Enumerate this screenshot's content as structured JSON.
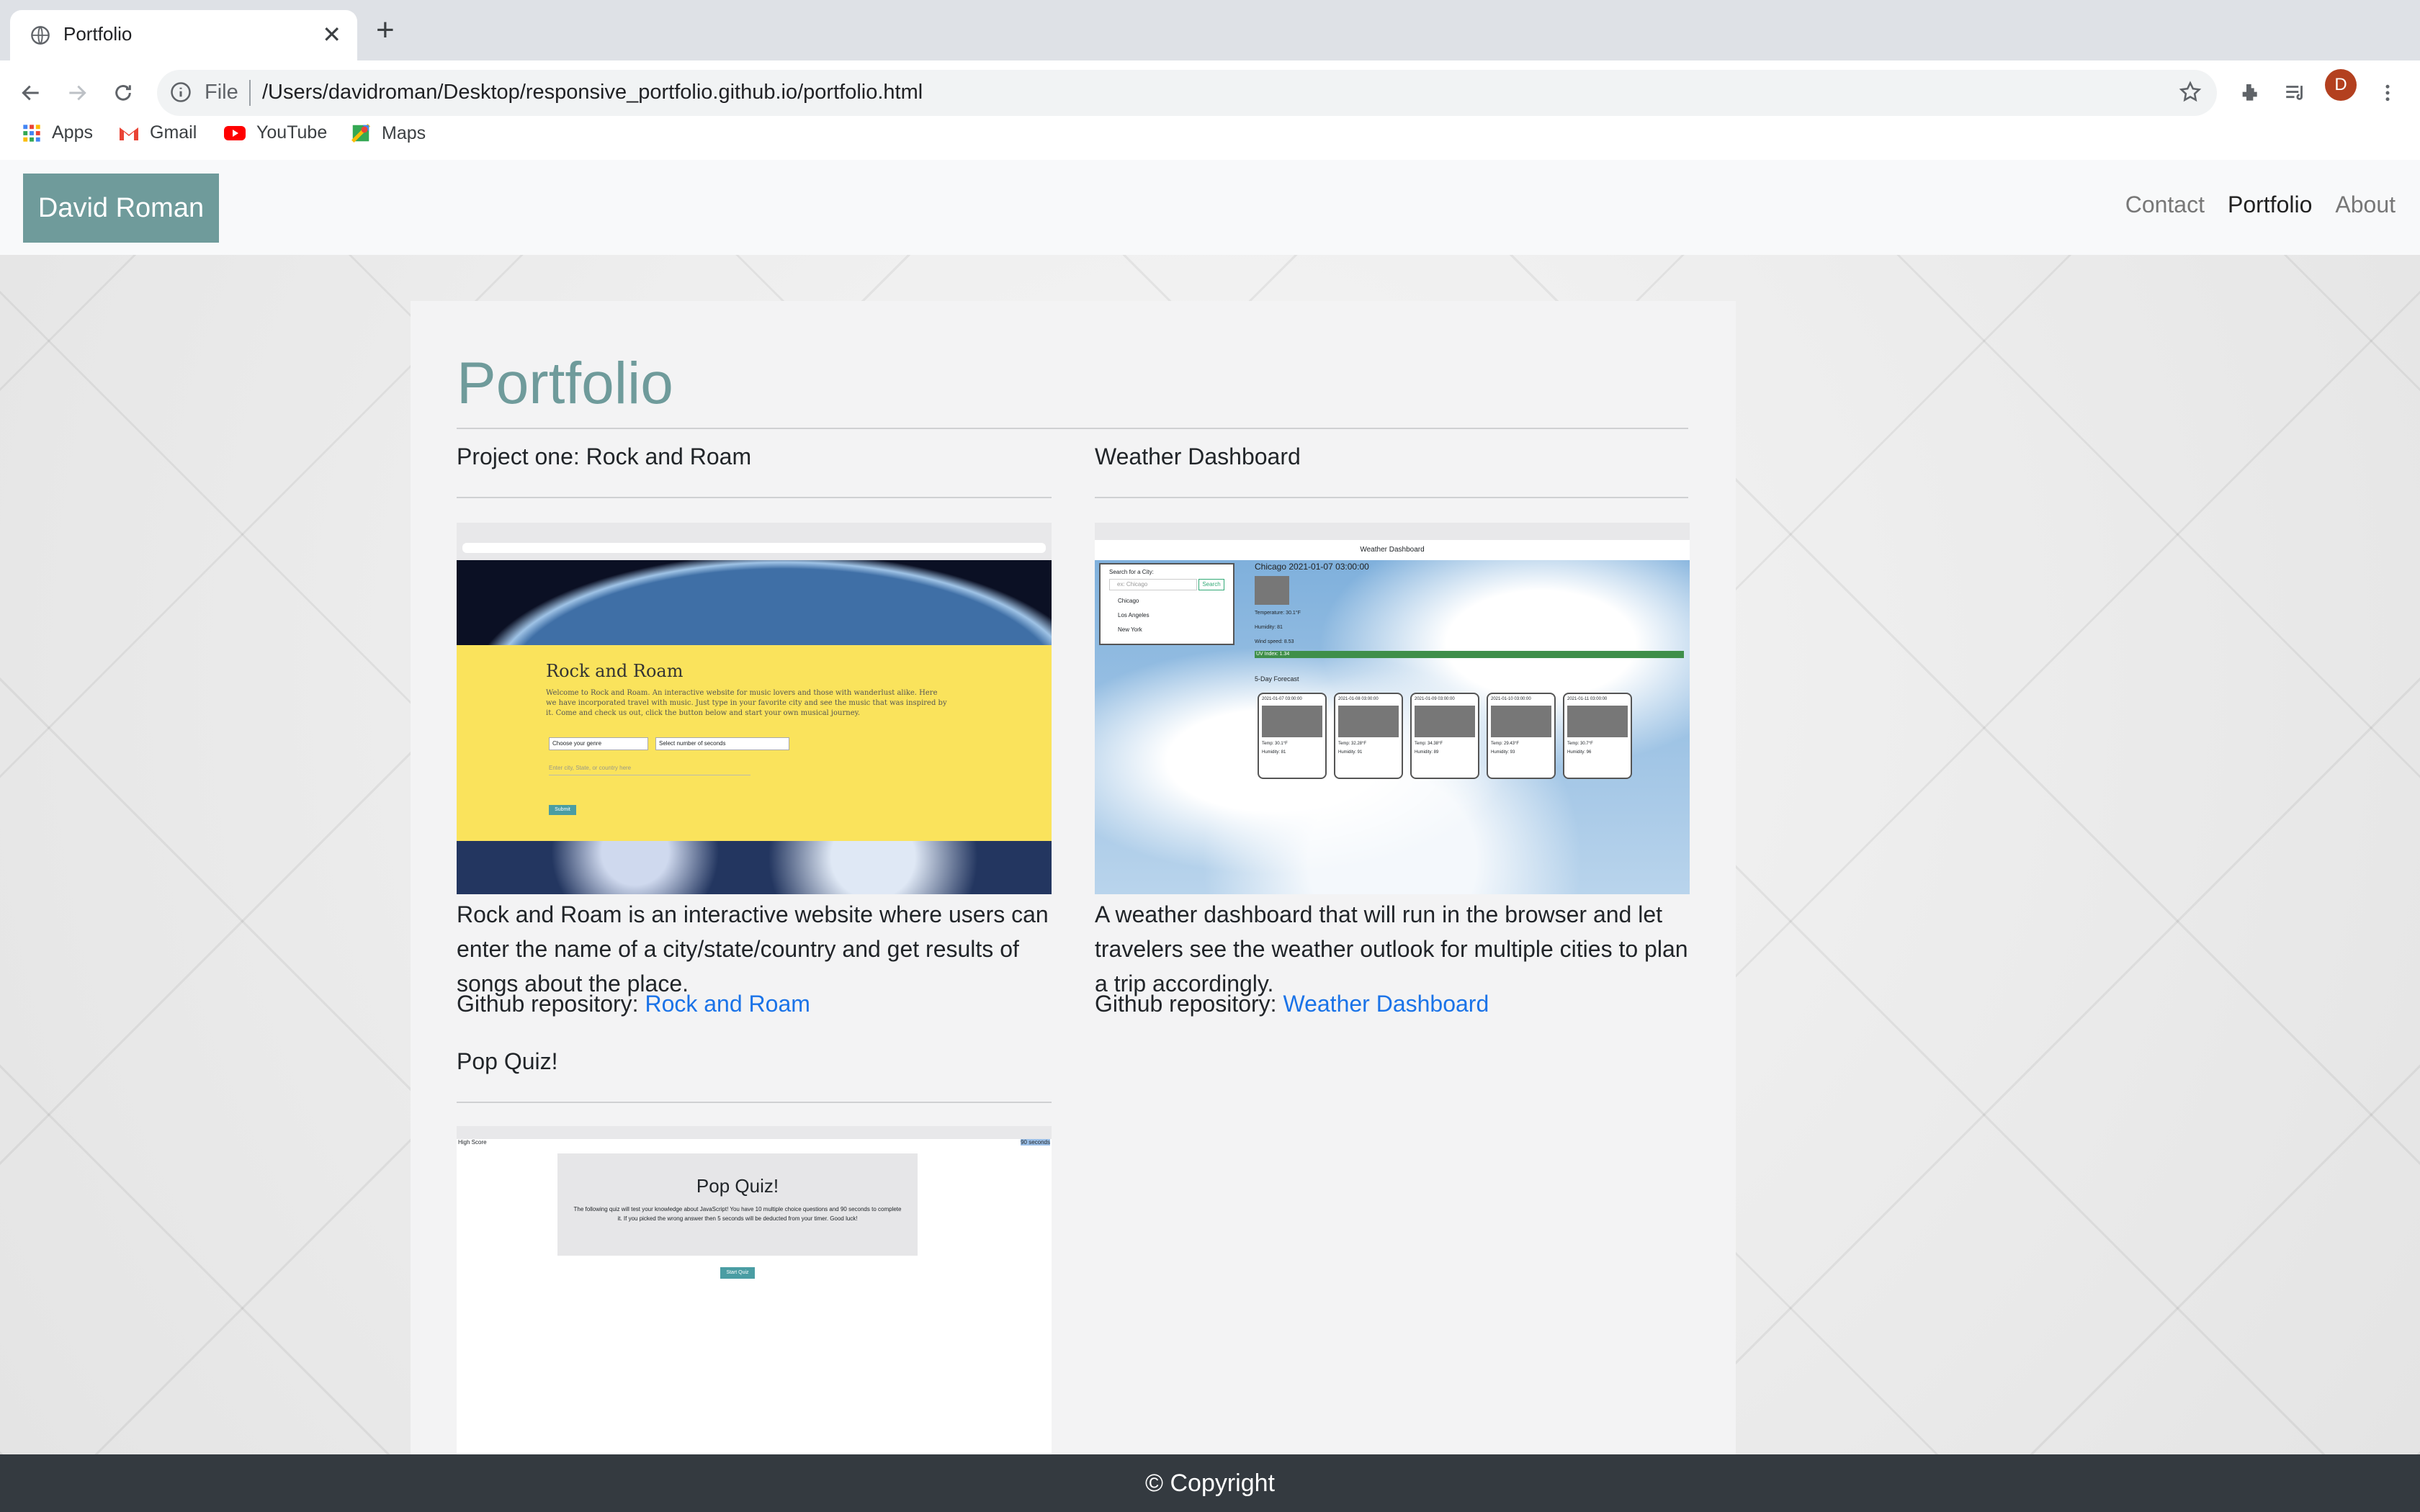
{
  "browser": {
    "tab_title": "Portfolio",
    "address_scheme": "File",
    "address_url": "/Users/davidroman/Desktop/responsive_portfolio.github.io/portfolio.html",
    "avatar_letter": "D",
    "bookmarks": [
      "Apps",
      "Gmail",
      "YouTube",
      "Maps"
    ]
  },
  "site": {
    "brand": "David Roman",
    "nav": [
      "Contact",
      "Portfolio",
      "About"
    ],
    "active_nav": "Portfolio",
    "accent_color": "#6f9b9b",
    "footer": "© Copyright"
  },
  "main": {
    "title": "Portfolio",
    "projects": [
      {
        "heading": "Project one: Rock and Roam",
        "description": "Rock and Roam is an interactive website where users can enter the name of a city/state/country and get results of songs about the place.",
        "repo_prefix": "Github repository:",
        "repo_link": "Rock and Roam",
        "shot": {
          "title": "Rock and Roam",
          "text": "Welcome to Rock and Roam. An interactive website for music lovers and those with wanderlust alike. Here we have incorporated travel with music. Just type in your favorite city and see the music that was inspired by it. Come and check us out, click the button below and start your own musical journey.",
          "select1": "Choose your genre",
          "select2": "Select number of seconds",
          "input": "Enter city, State, or country here",
          "button": "Submit"
        }
      },
      {
        "heading": "Weather Dashboard",
        "description": "A weather dashboard that will run in the browser and let travelers see the weather outlook for multiple cities to plan a trip accordingly.",
        "repo_prefix": "Github repository:",
        "repo_link": "Weather Dashboard",
        "shot": {
          "title": "Weather Dashboard",
          "search_label": "Search for a City:",
          "search_placeholder": "ex: Chicago",
          "search_button": "Search",
          "cities": [
            "Chicago",
            "Los Angeles",
            "New York"
          ],
          "current": "Chicago 2021-01-07 03:00:00",
          "temp": "Temperature: 30.1°F",
          "humidity": "Humidity: 81",
          "wind": "Wind speed: 8.53",
          "uv": "UV Index: 1.34",
          "forecast_title": "5-Day Forecast",
          "forecast": [
            {
              "date": "2021-01-07 03:00:00",
              "temp": "Temp: 30.1°F",
              "hum": "Humidity: 81"
            },
            {
              "date": "2021-01-08 03:00:00",
              "temp": "Temp: 32.28°F",
              "hum": "Humidity: 91"
            },
            {
              "date": "2021-01-09 03:00:00",
              "temp": "Temp: 34.38°F",
              "hum": "Humidity: 89"
            },
            {
              "date": "2021-01-10 03:00:00",
              "temp": "Temp: 29.43°F",
              "hum": "Humidity: 93"
            },
            {
              "date": "2021-01-11 03:00:00",
              "temp": "Temp: 30.7°F",
              "hum": "Humidity: 96"
            }
          ]
        }
      },
      {
        "heading": "Pop Quiz!",
        "shot": {
          "high_score": "High Score",
          "timer": "90 seconds",
          "title": "Pop Quiz!",
          "text": "The following quiz will test your knowledge about JavaScript! You have 10 multiple choice questions and 90 seconds to complete it. If you picked the wrong answer then 5 seconds will be deducted from your timer. Good luck!",
          "button": "Start Quiz"
        }
      }
    ]
  }
}
